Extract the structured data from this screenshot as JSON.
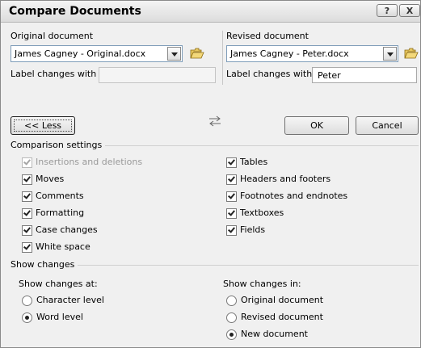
{
  "window": {
    "title": "Compare Documents",
    "help_btn": "?",
    "close_btn": "X"
  },
  "original": {
    "heading": "Original document",
    "value": "James Cagney - Original.docx",
    "label_changes": "Label changes with",
    "label_value": ""
  },
  "revised": {
    "heading": "Revised document",
    "value": "James Cagney - Peter.docx",
    "label_changes": "Label changes with",
    "label_value": "Peter"
  },
  "buttons": {
    "less": "<< Less",
    "ok": "OK",
    "cancel": "Cancel"
  },
  "comparison_settings": {
    "title": "Comparison settings",
    "left": [
      {
        "label": "Insertions and deletions",
        "checked": true,
        "disabled": true
      },
      {
        "label": "Moves",
        "checked": true,
        "disabled": false
      },
      {
        "label": "Comments",
        "checked": true,
        "disabled": false
      },
      {
        "label": "Formatting",
        "checked": true,
        "disabled": false
      },
      {
        "label": "Case changes",
        "checked": true,
        "disabled": false
      },
      {
        "label": "White space",
        "checked": true,
        "disabled": false
      }
    ],
    "right": [
      {
        "label": "Tables",
        "checked": true
      },
      {
        "label": "Headers and footers",
        "checked": true
      },
      {
        "label": "Footnotes and endnotes",
        "checked": true
      },
      {
        "label": "Textboxes",
        "checked": true
      },
      {
        "label": "Fields",
        "checked": true
      }
    ]
  },
  "show_changes": {
    "title": "Show changes",
    "at_label": "Show changes at:",
    "at_options": [
      {
        "label": "Character level",
        "selected": false
      },
      {
        "label": "Word level",
        "selected": true
      }
    ],
    "in_label": "Show changes in:",
    "in_options": [
      {
        "label": "Original document",
        "selected": false
      },
      {
        "label": "Revised document",
        "selected": false
      },
      {
        "label": "New document",
        "selected": true
      }
    ]
  },
  "icons": {
    "folder": "open-folder-icon",
    "swap": "swap-arrows-icon",
    "dropdown": "chevron-down-icon"
  }
}
